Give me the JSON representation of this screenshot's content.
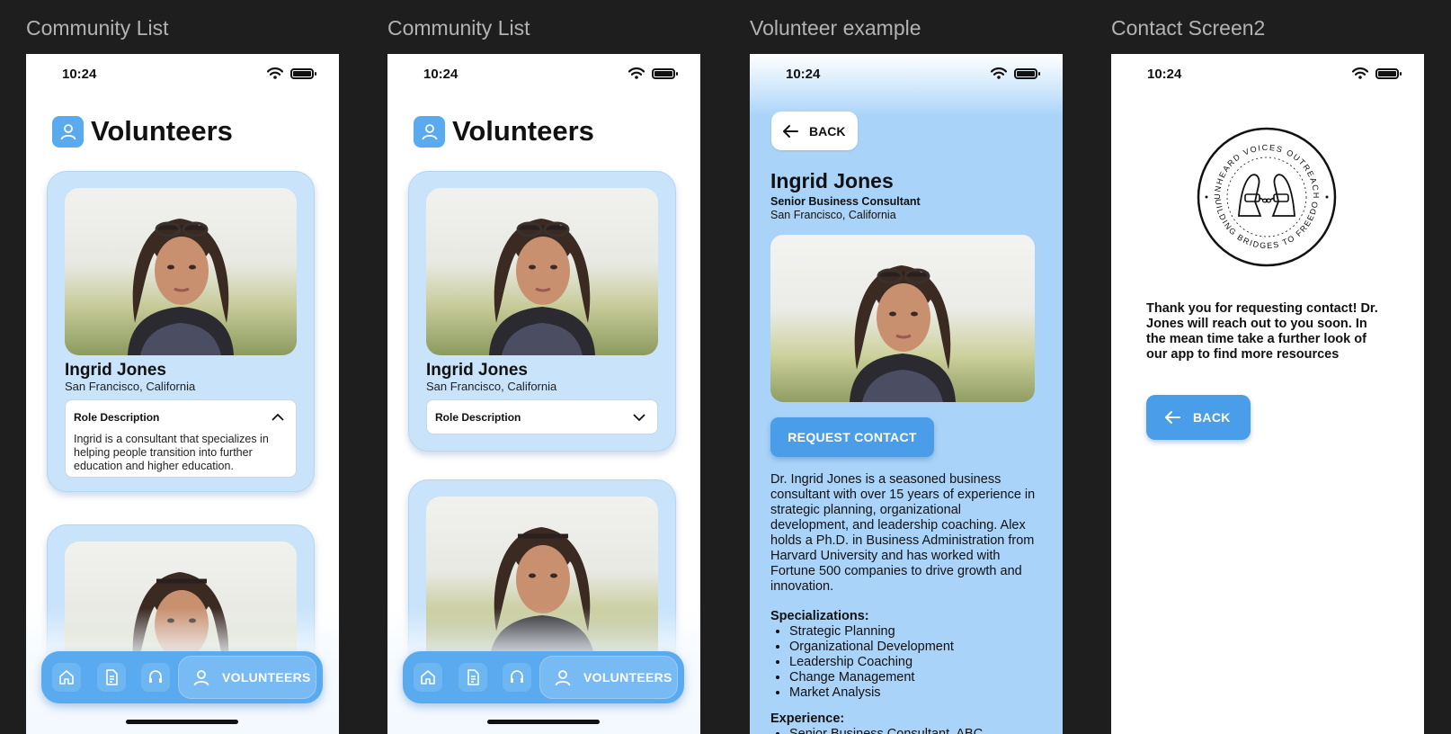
{
  "frames": [
    {
      "title": "Community List"
    },
    {
      "title": "Community List"
    },
    {
      "title": "Volunteer example"
    },
    {
      "title": "Contact Screen2"
    }
  ],
  "status": {
    "time": "10:24"
  },
  "list": {
    "header_title": "Volunteers",
    "volunteer": {
      "name": "Ingrid Jones",
      "location": "San Francisco, California",
      "role_heading": "Role Description",
      "role_text": "Ingrid is a consultant that specializes in helping people transition into further education and higher education."
    },
    "nav": {
      "active_label": "VOLUNTEERS"
    }
  },
  "detail": {
    "back_label": "BACK",
    "name": "Ingrid Jones",
    "role": "Senior Business Consultant",
    "location": "San Francisco, California",
    "request_label": "REQUEST CONTACT",
    "bio": "Dr. Ingrid Jones is a seasoned business consultant with over 15 years of experience in strategic planning, organizational development, and leadership coaching. Alex holds a Ph.D. in Business Administration from Harvard University and has worked with Fortune 500 companies to drive growth and innovation.",
    "specializations_heading": "Specializations:",
    "specializations": [
      "Strategic Planning",
      "Organizational Development",
      "Leadership Coaching",
      "Change Management",
      "Market Analysis"
    ],
    "experience_heading": "Experience:",
    "experience": [
      "Senior Business Consultant, ABC"
    ]
  },
  "contact": {
    "logo_text_top": "UNHEARD VOICES OUTREACH",
    "logo_text_bottom": "BUILDING BRIDGES TO FREEDOM",
    "message": "Thank you for requesting contact! Dr. Jones will reach out to you soon. In the mean time take a further look of our app to find more resources",
    "back_label": "BACK"
  },
  "colors": {
    "accent": "#5aaaf0",
    "card_bg": "#c8e3fa",
    "button": "#4a9de8",
    "canvas": "#1e1e1e"
  }
}
